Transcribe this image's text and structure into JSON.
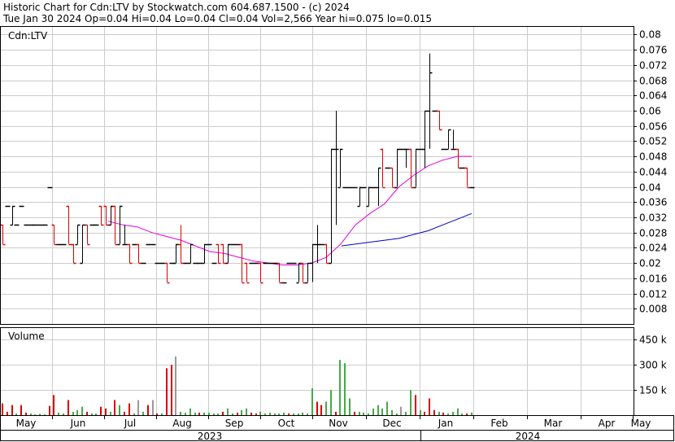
{
  "header": {
    "title": "Historic Chart for Cdn:LTV by Stockwatch.com 604.687.1500 - (c) 2024",
    "quote": "Tue Jan 30 2024  Op=0.04  Hi=0.04  Lo=0.04  Cl=0.04  Vol=2,566  Year hi=0.075  lo=0.015"
  },
  "colors": {
    "up": "#000000",
    "down": "#dd0000",
    "ma_short": "#e000e0",
    "ma_long": "#0000cc",
    "vol_up": "#44aa44",
    "vol_down": "#dd0000",
    "vol_neutral": "#999999",
    "grid": "#cccccc"
  },
  "chart_data": [
    {
      "type": "ohlc",
      "label": "Cdn:LTV",
      "y_ticks": [
        "0.008",
        "0.012",
        "0.016",
        "0.02",
        "0.024",
        "0.028",
        "0.032",
        "0.036",
        "0.04",
        "0.044",
        "0.048",
        "0.052",
        "0.056",
        "0.06",
        "0.064",
        "0.068",
        "0.072",
        "0.076",
        "0.08"
      ],
      "ylim": [
        0.004,
        0.082
      ],
      "x_tick_labels": [
        "May",
        "Jun",
        "Jul",
        "Aug",
        "Sep",
        "Oct",
        "Nov",
        "Dec",
        "Jan",
        "Feb",
        "Mar",
        "Apr",
        "May"
      ],
      "year_labels": [
        "2023",
        "2024"
      ],
      "grid": true,
      "bars": [
        [
          0.03,
          0.03,
          0.025,
          0.025
        ],
        [
          0.035,
          0.035,
          0.035,
          0.035
        ],
        [
          0.03,
          0.035,
          0.03,
          0.035
        ],
        [
          0.03,
          0.03,
          0.03,
          0.03
        ],
        [
          0.035,
          0.035,
          0.035,
          0.035
        ],
        [
          0.03,
          0.03,
          0.03,
          0.03
        ],
        [
          0.03,
          0.03,
          0.03,
          0.03
        ],
        [
          0.03,
          0.03,
          0.03,
          0.03
        ],
        [
          0.03,
          0.03,
          0.03,
          0.03
        ],
        [
          0.03,
          0.03,
          0.03,
          0.03
        ],
        [
          0.04,
          0.04,
          0.04,
          0.04
        ],
        [
          0.03,
          0.03,
          0.025,
          0.025
        ],
        [
          0.025,
          0.025,
          0.025,
          0.025
        ],
        [
          0.025,
          0.025,
          0.025,
          0.025
        ],
        [
          0.035,
          0.035,
          0.025,
          0.025
        ],
        [
          0.025,
          0.025,
          0.02,
          0.02
        ],
        [
          0.025,
          0.03,
          0.025,
          0.03
        ],
        [
          0.02,
          0.03,
          0.02,
          0.03
        ],
        [
          0.03,
          0.03,
          0.025,
          0.025
        ],
        [
          0.03,
          0.03,
          0.03,
          0.03
        ],
        [
          0.03,
          0.03,
          0.03,
          0.03
        ],
        [
          0.035,
          0.035,
          0.03,
          0.03
        ],
        [
          0.035,
          0.035,
          0.03,
          0.03
        ],
        [
          0.03,
          0.035,
          0.03,
          0.035
        ],
        [
          0.035,
          0.035,
          0.025,
          0.025
        ],
        [
          0.025,
          0.035,
          0.025,
          0.035
        ],
        [
          0.025,
          0.03,
          0.025,
          0.025
        ],
        [
          0.025,
          0.025,
          0.02,
          0.02
        ],
        [
          0.025,
          0.025,
          0.025,
          0.025
        ],
        [
          0.025,
          0.025,
          0.02,
          0.02
        ],
        [
          0.02,
          0.02,
          0.02,
          0.02
        ],
        [
          0.025,
          0.025,
          0.025,
          0.025
        ],
        [
          0.025,
          0.025,
          0.025,
          0.025
        ],
        [
          0.02,
          0.02,
          0.02,
          0.02
        ],
        [
          0.02,
          0.02,
          0.02,
          0.02
        ],
        [
          0.02,
          0.02,
          0.015,
          0.015
        ],
        [
          0.02,
          0.02,
          0.02,
          0.02
        ],
        [
          0.02,
          0.025,
          0.02,
          0.025
        ],
        [
          0.025,
          0.03,
          0.02,
          0.02
        ],
        [
          0.02,
          0.02,
          0.02,
          0.02
        ],
        [
          0.02,
          0.025,
          0.02,
          0.025
        ],
        [
          0.02,
          0.02,
          0.02,
          0.02
        ],
        [
          0.02,
          0.02,
          0.02,
          0.02
        ],
        [
          0.02,
          0.025,
          0.02,
          0.025
        ],
        [
          0.025,
          0.025,
          0.025,
          0.025
        ],
        [
          0.02,
          0.02,
          0.02,
          0.02
        ],
        [
          0.025,
          0.025,
          0.02,
          0.02
        ],
        [
          0.025,
          0.025,
          0.02,
          0.02
        ],
        [
          0.02,
          0.025,
          0.02,
          0.025
        ],
        [
          0.025,
          0.025,
          0.025,
          0.025
        ],
        [
          0.025,
          0.025,
          0.025,
          0.025
        ],
        [
          0.025,
          0.025,
          0.015,
          0.015
        ],
        [
          0.02,
          0.02,
          0.015,
          0.015
        ],
        [
          0.02,
          0.02,
          0.02,
          0.02
        ],
        [
          0.02,
          0.02,
          0.02,
          0.02
        ],
        [
          0.02,
          0.02,
          0.015,
          0.015
        ],
        [
          0.02,
          0.02,
          0.02,
          0.02
        ],
        [
          0.02,
          0.02,
          0.02,
          0.02
        ],
        [
          0.02,
          0.02,
          0.02,
          0.02
        ],
        [
          0.02,
          0.02,
          0.015,
          0.015
        ],
        [
          0.015,
          0.015,
          0.015,
          0.015
        ],
        [
          0.02,
          0.02,
          0.02,
          0.02
        ],
        [
          0.02,
          0.02,
          0.02,
          0.02
        ],
        [
          0.015,
          0.02,
          0.015,
          0.02
        ],
        [
          0.02,
          0.02,
          0.015,
          0.015
        ],
        [
          0.015,
          0.02,
          0.015,
          0.02
        ],
        [
          0.02,
          0.025,
          0.015,
          0.025
        ],
        [
          0.025,
          0.03,
          0.02,
          0.025
        ],
        [
          0.025,
          0.025,
          0.025,
          0.025
        ],
        [
          0.025,
          0.025,
          0.02,
          0.02
        ],
        [
          0.02,
          0.05,
          0.02,
          0.05
        ],
        [
          0.05,
          0.06,
          0.03,
          0.05
        ],
        [
          0.04,
          0.05,
          0.04,
          0.05
        ],
        [
          0.04,
          0.04,
          0.04,
          0.04
        ],
        [
          0.04,
          0.04,
          0.04,
          0.04
        ],
        [
          0.04,
          0.04,
          0.04,
          0.04
        ],
        [
          0.035,
          0.04,
          0.035,
          0.04
        ],
        [
          0.04,
          0.04,
          0.04,
          0.04
        ],
        [
          0.035,
          0.04,
          0.035,
          0.04
        ],
        [
          0.04,
          0.04,
          0.04,
          0.04
        ],
        [
          0.04,
          0.045,
          0.035,
          0.045
        ],
        [
          0.05,
          0.05,
          0.04,
          0.04
        ],
        [
          0.045,
          0.045,
          0.045,
          0.045
        ],
        [
          0.045,
          0.045,
          0.04,
          0.04
        ],
        [
          0.04,
          0.05,
          0.04,
          0.05
        ],
        [
          0.05,
          0.05,
          0.05,
          0.05
        ],
        [
          0.05,
          0.05,
          0.045,
          0.05
        ],
        [
          0.05,
          0.05,
          0.04,
          0.04
        ],
        [
          0.04,
          0.05,
          0.04,
          0.05
        ],
        [
          0.05,
          0.05,
          0.05,
          0.05
        ],
        [
          0.05,
          0.06,
          0.045,
          0.06
        ],
        [
          0.06,
          0.075,
          0.05,
          0.07
        ],
        [
          0.06,
          0.06,
          0.06,
          0.06
        ],
        [
          0.06,
          0.06,
          0.055,
          0.055
        ],
        [
          0.05,
          0.05,
          0.05,
          0.05
        ],
        [
          0.05,
          0.055,
          0.05,
          0.055
        ],
        [
          0.05,
          0.055,
          0.05,
          0.05
        ],
        [
          0.05,
          0.05,
          0.045,
          0.045
        ],
        [
          0.045,
          0.045,
          0.045,
          0.045
        ],
        [
          0.045,
          0.045,
          0.04,
          0.04
        ],
        [
          0.04,
          0.04,
          0.04,
          0.04
        ]
      ],
      "ma_short": [
        0.031,
        0.03,
        0.0295,
        0.028,
        0.027,
        0.026,
        0.0245,
        0.023,
        0.0225,
        0.0215,
        0.0205,
        0.02,
        0.0195,
        0.0195,
        0.02,
        0.0215,
        0.025,
        0.03,
        0.033,
        0.0355,
        0.04,
        0.043,
        0.0455,
        0.047,
        0.048,
        0.048
      ],
      "ma_long": [
        0.0245,
        0.025,
        0.0255,
        0.026,
        0.0265,
        0.0275,
        0.0285,
        0.03,
        0.0315,
        0.033
      ]
    },
    {
      "type": "bar",
      "label": "Volume",
      "y_ticks": [
        "150 k",
        "300 k",
        "450 k"
      ],
      "ylim": [
        0,
        520000
      ],
      "volumes": [
        [
          70000,
          "d"
        ],
        [
          20000,
          "d"
        ],
        [
          60000,
          "d"
        ],
        [
          10000,
          "g"
        ],
        [
          60000,
          "d"
        ],
        [
          15000,
          "d"
        ],
        [
          10000,
          "g"
        ],
        [
          5000,
          "g"
        ],
        [
          8000,
          "g"
        ],
        [
          5000,
          "g"
        ],
        [
          55000,
          "d"
        ],
        [
          120000,
          "d"
        ],
        [
          15000,
          "g"
        ],
        [
          10000,
          "g"
        ],
        [
          90000,
          "d"
        ],
        [
          20000,
          "g"
        ],
        [
          30000,
          "g"
        ],
        [
          50000,
          "g"
        ],
        [
          20000,
          "d"
        ],
        [
          10000,
          "g"
        ],
        [
          10000,
          "g"
        ],
        [
          50000,
          "d"
        ],
        [
          40000,
          "d"
        ],
        [
          20000,
          "g"
        ],
        [
          90000,
          "d"
        ],
        [
          60000,
          "g"
        ],
        [
          20000,
          "d"
        ],
        [
          70000,
          "d"
        ],
        [
          10000,
          "g"
        ],
        [
          90000,
          "n"
        ],
        [
          20000,
          "g"
        ],
        [
          60000,
          "d"
        ],
        [
          90000,
          "n"
        ],
        [
          10000,
          "d"
        ],
        [
          10000,
          "g"
        ],
        [
          280000,
          "d"
        ],
        [
          300000,
          "d"
        ],
        [
          350000,
          "n"
        ],
        [
          20000,
          "g"
        ],
        [
          15000,
          "g"
        ],
        [
          40000,
          "g"
        ],
        [
          15000,
          "g"
        ],
        [
          15000,
          "d"
        ],
        [
          15000,
          "g"
        ],
        [
          15000,
          "g"
        ],
        [
          10000,
          "g"
        ],
        [
          10000,
          "g"
        ],
        [
          20000,
          "d"
        ],
        [
          40000,
          "g"
        ],
        [
          10000,
          "g"
        ],
        [
          15000,
          "d"
        ],
        [
          30000,
          "g"
        ],
        [
          40000,
          "g"
        ],
        [
          15000,
          "d"
        ],
        [
          10000,
          "d"
        ],
        [
          20000,
          "g"
        ],
        [
          10000,
          "g"
        ],
        [
          15000,
          "g"
        ],
        [
          10000,
          "g"
        ],
        [
          10000,
          "g"
        ],
        [
          15000,
          "g"
        ],
        [
          10000,
          "d"
        ],
        [
          10000,
          "g"
        ],
        [
          10000,
          "g"
        ],
        [
          15000,
          "g"
        ],
        [
          10000,
          "g"
        ],
        [
          160000,
          "g"
        ],
        [
          80000,
          "d"
        ],
        [
          60000,
          "d"
        ],
        [
          80000,
          "g"
        ],
        [
          150000,
          "g"
        ],
        [
          20000,
          "d"
        ],
        [
          330000,
          "g"
        ],
        [
          310000,
          "g"
        ],
        [
          100000,
          "g"
        ],
        [
          20000,
          "d"
        ],
        [
          20000,
          "g"
        ],
        [
          15000,
          "g"
        ],
        [
          10000,
          "g"
        ],
        [
          40000,
          "g"
        ],
        [
          60000,
          "g"
        ],
        [
          40000,
          "g"
        ],
        [
          80000,
          "g"
        ],
        [
          30000,
          "g"
        ],
        [
          10000,
          "g"
        ],
        [
          50000,
          "n"
        ],
        [
          20000,
          "g"
        ],
        [
          150000,
          "g"
        ],
        [
          120000,
          "d"
        ],
        [
          30000,
          "g"
        ],
        [
          20000,
          "d"
        ],
        [
          100000,
          "d"
        ],
        [
          30000,
          "d"
        ],
        [
          20000,
          "g"
        ],
        [
          15000,
          "d"
        ],
        [
          10000,
          "g"
        ],
        [
          20000,
          "g"
        ],
        [
          40000,
          "g"
        ],
        [
          10000,
          "g"
        ],
        [
          10000,
          "d"
        ],
        [
          15000,
          "g"
        ]
      ]
    }
  ]
}
